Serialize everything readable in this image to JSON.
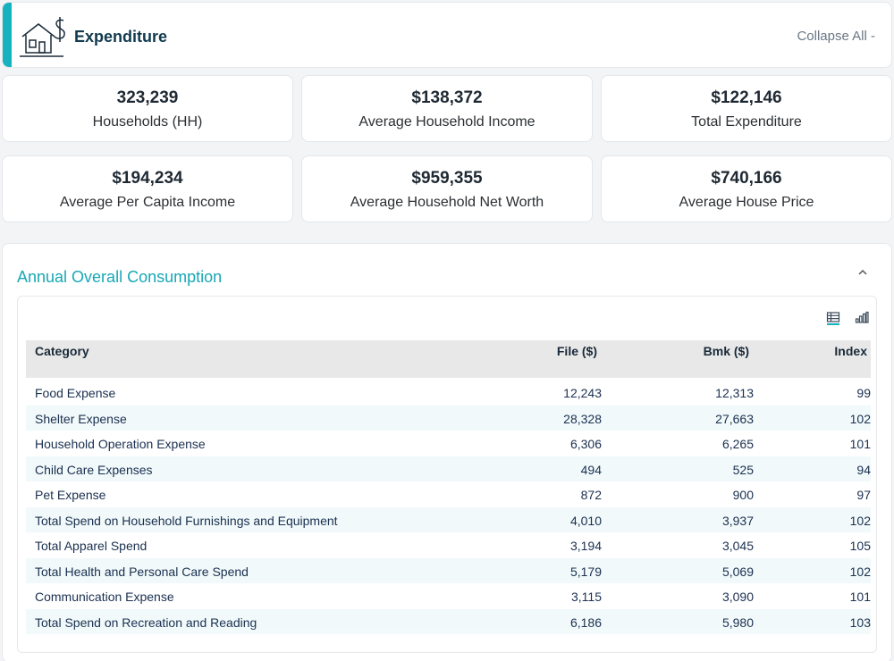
{
  "header": {
    "title": "Expenditure",
    "collapse_label": "Collapse All -",
    "accent_color": "#16b2c0"
  },
  "stats": [
    {
      "value": "323,239",
      "label": "Households (HH)"
    },
    {
      "value": "$138,372",
      "label": "Average Household Income"
    },
    {
      "value": "$122,146",
      "label": "Total Expenditure"
    },
    {
      "value": "$194,234",
      "label": "Average Per Capita Income"
    },
    {
      "value": "$959,355",
      "label": "Average Household Net Worth"
    },
    {
      "value": "$740,166",
      "label": "Average House Price"
    }
  ],
  "consumption": {
    "title": "Annual Overall Consumption",
    "icons": [
      "table-view-icon",
      "chart-view-icon"
    ],
    "columns": [
      "Category",
      "File ($)",
      "Bmk ($)",
      "Index"
    ],
    "rows": [
      [
        "Food Expense",
        "12,243",
        "12,313",
        "99"
      ],
      [
        "Shelter Expense",
        "28,328",
        "27,663",
        "102"
      ],
      [
        "Household Operation Expense",
        "6,306",
        "6,265",
        "101"
      ],
      [
        "Child Care Expenses",
        "494",
        "525",
        "94"
      ],
      [
        "Pet Expense",
        "872",
        "900",
        "97"
      ],
      [
        "Total Spend on Household Furnishings and Equipment",
        "4,010",
        "3,937",
        "102"
      ],
      [
        "Total Apparel Spend",
        "3,194",
        "3,045",
        "105"
      ],
      [
        "Total Health and Personal Care Spend",
        "5,179",
        "5,069",
        "102"
      ],
      [
        "Communication Expense",
        "3,115",
        "3,090",
        "101"
      ],
      [
        "Total Spend on Recreation and Reading",
        "6,186",
        "5,980",
        "103"
      ]
    ]
  }
}
